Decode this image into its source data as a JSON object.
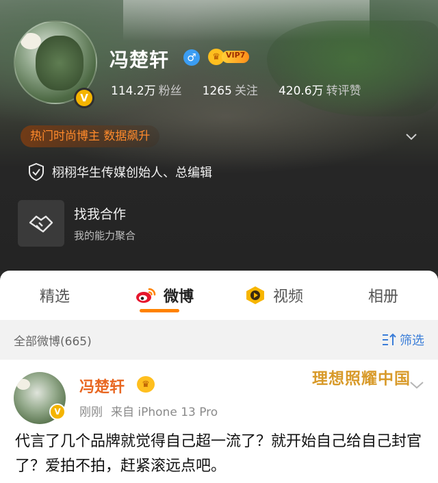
{
  "profile": {
    "name": "冯楚轩",
    "gender_icon": "male-icon",
    "vip_label": "VIP7",
    "verified_icon": "verified-v-icon",
    "stats": [
      {
        "num": "114.2万",
        "label": "粉丝"
      },
      {
        "num": "1265",
        "label": "关注"
      },
      {
        "num": "420.6万",
        "label": "转评赞"
      }
    ],
    "hot_tag": "热门时尚博主 数据飙升",
    "certification": "栩栩华生传媒创始人、总编辑",
    "cooperation": {
      "title": "找我合作",
      "subtitle": "我的能力聚合"
    }
  },
  "tabs": [
    {
      "label": "精选",
      "active": false
    },
    {
      "label": "微博",
      "active": true,
      "icon": "weibo-logo-icon"
    },
    {
      "label": "视频",
      "active": false,
      "icon": "video-play-icon"
    },
    {
      "label": "相册",
      "active": false
    }
  ],
  "filter": {
    "all_label": "全部微博(665)",
    "filter_label": "筛选"
  },
  "post": {
    "author": "冯楚轩",
    "time": "刚刚",
    "source": "来自 iPhone 13 Pro",
    "watermark": "理想照耀中国",
    "text": "代言了几个品牌就觉得自己超一流了？就开始自己给自己封官了？爱拍不拍，赶紧滚远点吧。"
  },
  "colors": {
    "accent_orange": "#ff8200",
    "username_orange": "#e86722",
    "filter_blue": "#3a7dd8",
    "hot_tag_orange": "#ff8a2b"
  }
}
